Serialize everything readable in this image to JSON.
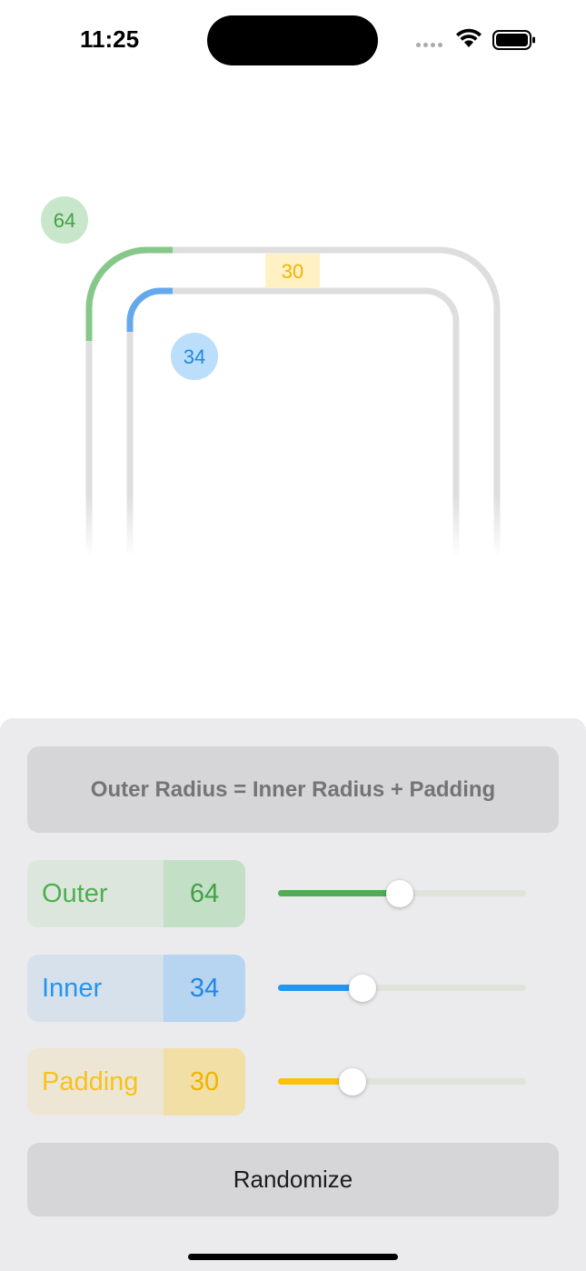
{
  "status_bar": {
    "time": "11:25"
  },
  "preview": {
    "outer_label": "64",
    "inner_label": "34",
    "padding_label": "30"
  },
  "controls": {
    "formula": "Outer Radius = Inner Radius + Padding",
    "outer": {
      "label": "Outer",
      "value": "64",
      "slider_fraction": 0.49,
      "color": "#4caf50"
    },
    "inner": {
      "label": "Inner",
      "value": "34",
      "slider_fraction": 0.34,
      "color": "#2196f3"
    },
    "padding": {
      "label": "Padding",
      "value": "30",
      "slider_fraction": 0.3,
      "color": "#ffc107"
    },
    "randomize_label": "Randomize"
  }
}
